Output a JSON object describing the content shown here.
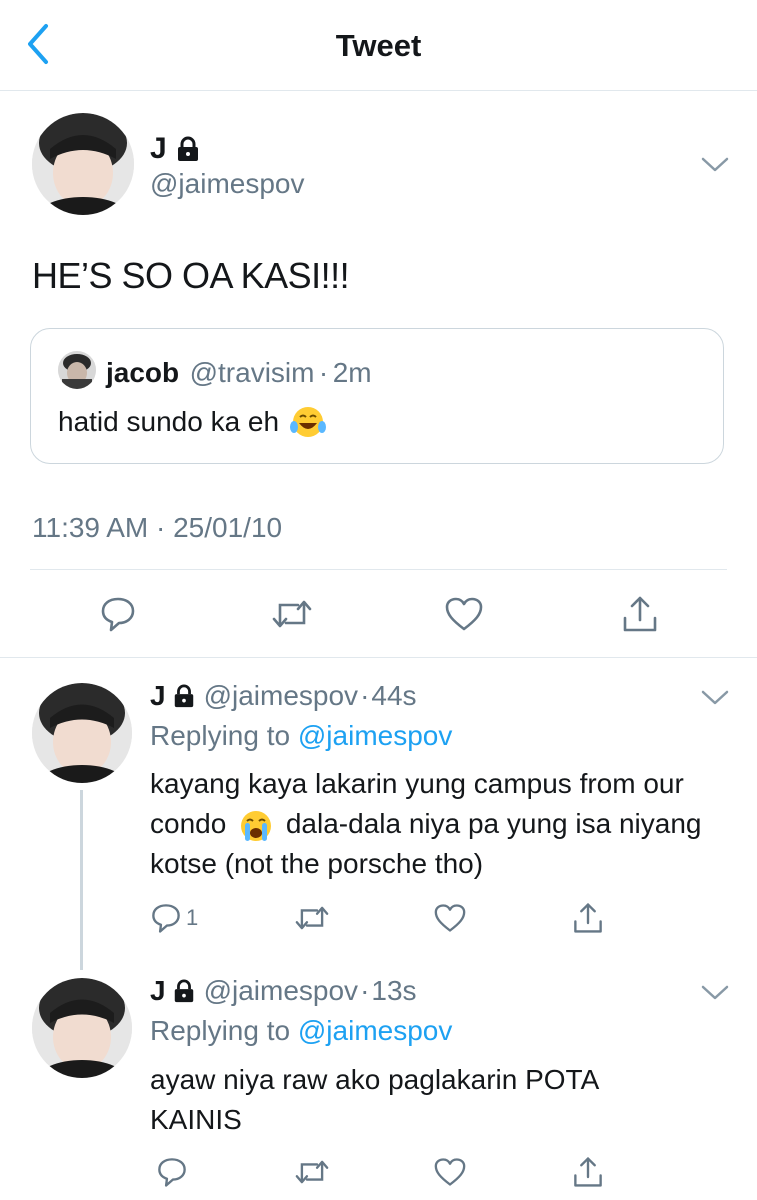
{
  "header": {
    "title": "Tweet"
  },
  "tweet": {
    "name": "J",
    "handle": "@jaimespov",
    "text": "HE’S SO OA KASI!!!",
    "quote": {
      "name": "jacob",
      "handle": "@travisim",
      "sep": "·",
      "time": "2m",
      "text": "hatid sundo ka eh"
    },
    "timestamp": "11:39 AM · 25/01/10"
  },
  "replies": [
    {
      "name": "J",
      "handle": "@jaimespov",
      "sep": "·",
      "time": "44s",
      "replying_label": "Replying to",
      "replying_to": "@jaimespov",
      "text_part1": "kayang kaya lakarin yung campus from our condo",
      "text_part2": "dala-dala niya pa yung isa niyang kotse (not the porsche tho)",
      "reply_count": "1"
    },
    {
      "name": "J",
      "handle": "@jaimespov",
      "sep": "·",
      "time": "13s",
      "replying_label": "Replying to",
      "replying_to": "@jaimespov",
      "text": "ayaw niya raw ako paglakarin POTA KAINIS"
    }
  ],
  "colors": {
    "accent": "#1da1f2",
    "muted": "#657786",
    "divider": "#e1e8ed"
  },
  "icons": [
    "back-chevron-icon",
    "lock-icon",
    "chevron-down-icon",
    "reply-icon",
    "retweet-icon",
    "like-icon",
    "share-icon",
    "laughing-tears-emoji",
    "crying-emoji"
  ]
}
